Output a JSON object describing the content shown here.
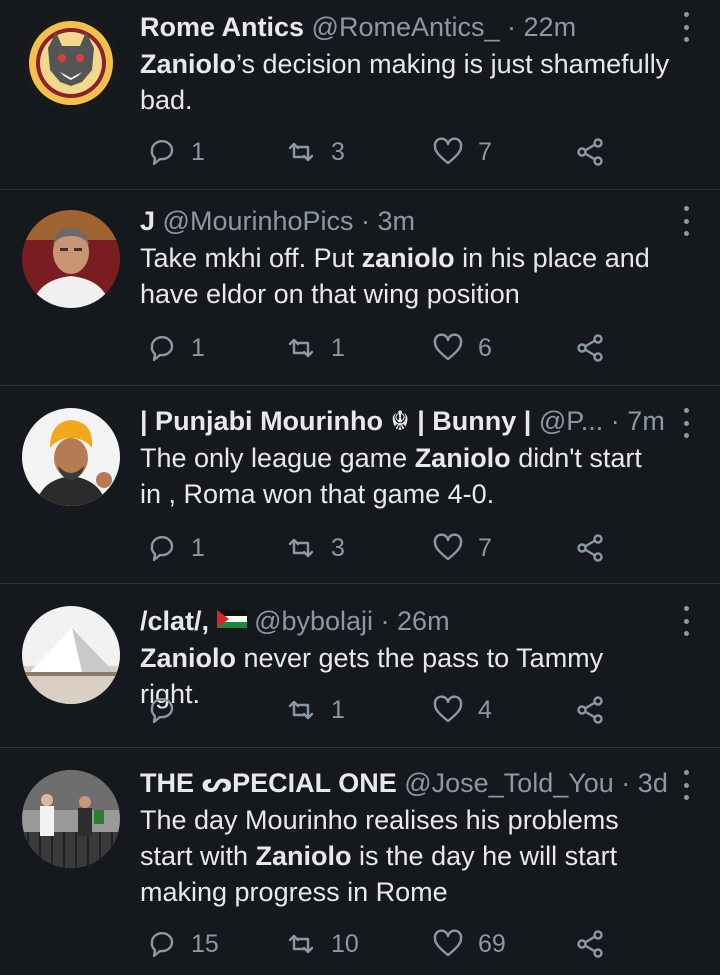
{
  "tweets": [
    {
      "name": "Rome Antics",
      "handle": "@RomeAntics_",
      "sep": " · ",
      "time": "22m",
      "text_parts": [
        "Zaniolo",
        "’s decision making is just shamefully bad."
      ],
      "reply_count": "1",
      "retweet_count": "3",
      "like_count": "7",
      "avatar_icon": "wolf-logo-avatar"
    },
    {
      "name": "J",
      "handle": "@MourinhoPics",
      "sep": " · ",
      "time": "3m",
      "text_parts": [
        "Take mkhi off. Put ",
        "zaniolo",
        " in his place and have eldor on that wing position"
      ],
      "reply_count": "1",
      "retweet_count": "1",
      "like_count": "6",
      "avatar_icon": "man-portrait-avatar"
    },
    {
      "name": "| Punjabi Mourinho ☬ | Bunny |",
      "handle": "@P...",
      "sep": " · ",
      "time": "7m",
      "text_parts": [
        "The only league game ",
        "Zaniolo",
        " didn't start in , Roma won that game 4-0."
      ],
      "reply_count": "1",
      "retweet_count": "3",
      "like_count": "7",
      "avatar_icon": "turban-portrait-avatar"
    },
    {
      "name": "/clat/,",
      "handle": "@bybolaji",
      "sep": " · ",
      "time": "26m",
      "text_parts": [
        "Zaniolo",
        " never gets the pass to Tammy right."
      ],
      "reply_count": "",
      "retweet_count": "1",
      "like_count": "4",
      "avatar_icon": "pyramid-avatar"
    },
    {
      "name": "THE ᔕPECIAL ONE",
      "handle": "@Jose_Told_You",
      "sep": " · ",
      "time": "3d",
      "text_parts": [
        "The day Mourinho realises his problems start with ",
        "Zaniolo",
        " is the day he will start making progress in Rome"
      ],
      "reply_count": "15",
      "retweet_count": "10",
      "like_count": "69",
      "avatar_icon": "balcony-photo-avatar"
    }
  ],
  "colors": {
    "background": "#15181c",
    "text": "#e7e9ea",
    "muted": "#8b98a5",
    "divider": "#2f3336"
  }
}
